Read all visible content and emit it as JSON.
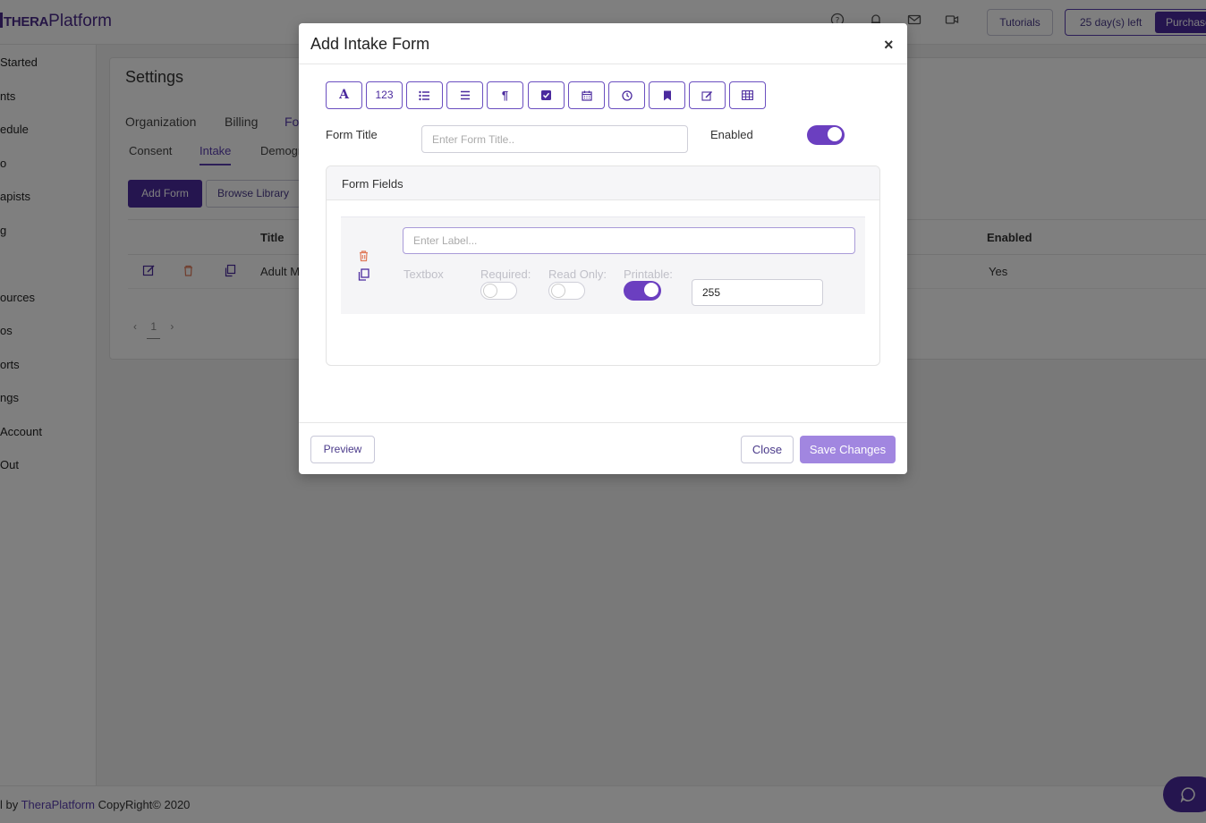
{
  "topbar": {
    "logo_bold": "THERA",
    "logo_light": "Platform",
    "tutorials_label": "Tutorials",
    "trial_label": "25 day(s) left",
    "purchase_label": "Purchase"
  },
  "sidebar": {
    "items": [
      "Started",
      "nts",
      "edule",
      "o",
      "apists",
      "g",
      "",
      "ources",
      "os",
      "orts",
      "ngs",
      "Account",
      " Out"
    ]
  },
  "settings": {
    "title": "Settings",
    "tabs": [
      "Organization",
      "Billing",
      "Fo"
    ],
    "sub_tabs": [
      "Consent",
      "Intake",
      "Demogr"
    ],
    "add_form_label": "Add Form",
    "browse_library_label": "Browse Library",
    "table": {
      "headers": [
        "Title",
        "Enabled"
      ],
      "rows": [
        {
          "title": "Adult M",
          "enabled": "Yes"
        }
      ]
    },
    "pager": {
      "page": "1"
    }
  },
  "footer": {
    "prefix": "l by ",
    "brand": "TheraPlatform",
    "suffix": " CopyRight© 2020"
  },
  "modal": {
    "title": "Add Intake Form",
    "close_symbol": "×",
    "toolbar": [
      {
        "icon": "text-icon",
        "glyph": "A"
      },
      {
        "icon": "number-icon",
        "glyph": "123"
      },
      {
        "icon": "list-icon",
        "glyph": ""
      },
      {
        "icon": "align-icon",
        "glyph": ""
      },
      {
        "icon": "paragraph-icon",
        "glyph": "¶"
      },
      {
        "icon": "checkbox-icon",
        "glyph": ""
      },
      {
        "icon": "calendar-icon",
        "glyph": ""
      },
      {
        "icon": "clock-icon",
        "glyph": ""
      },
      {
        "icon": "bookmark-icon",
        "glyph": ""
      },
      {
        "icon": "signature-icon",
        "glyph": ""
      },
      {
        "icon": "table-icon",
        "glyph": ""
      }
    ],
    "form_title_label": "Form Title",
    "form_title_placeholder": "Enter Form Title..",
    "enabled_label": "Enabled",
    "enabled_on": true,
    "fields_header": "Form Fields",
    "field": {
      "label_placeholder": "Enter Label...",
      "type": "Textbox",
      "required_label": "Required:",
      "read_only_label": "Read Only:",
      "printable_label": "Printable:",
      "required_on": false,
      "read_only_on": false,
      "printable_on": true,
      "max_length": "255"
    },
    "preview_label": "Preview",
    "close_label": "Close",
    "save_label": "Save Changes"
  },
  "colors": {
    "accent": "#4b2a9e",
    "toggle_on": "#6b3fc0",
    "save_button": "#a186e0",
    "delete": "#e07a5a"
  }
}
